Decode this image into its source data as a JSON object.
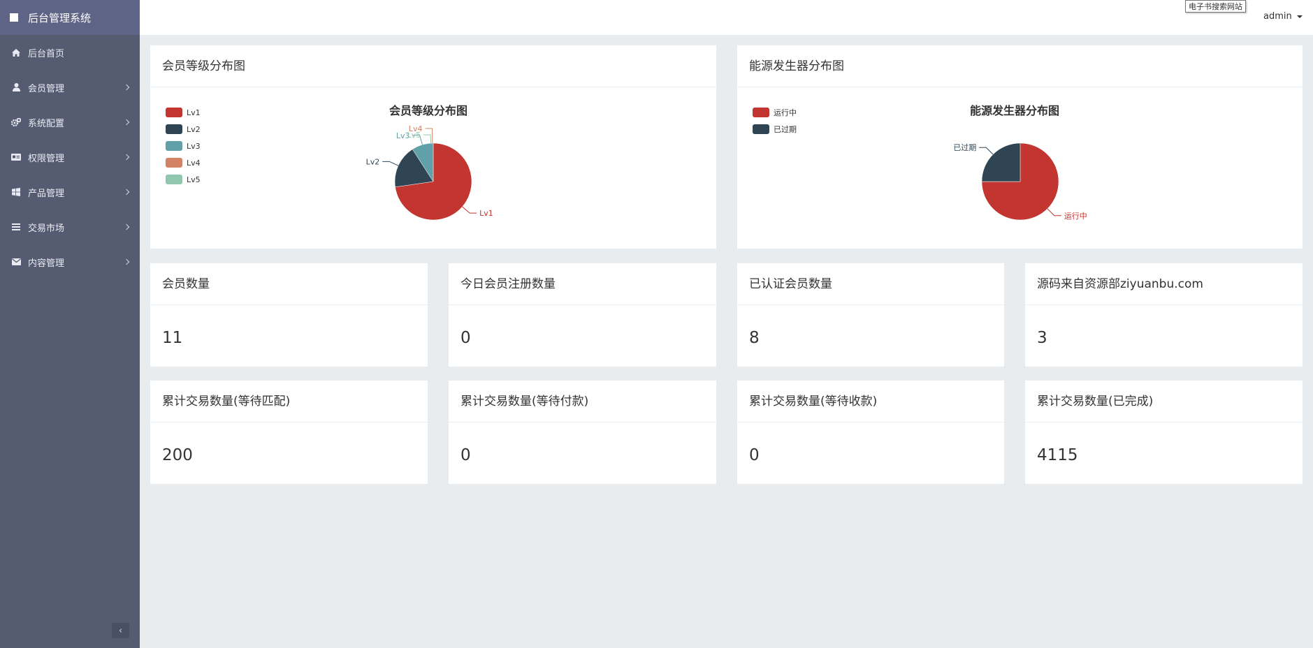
{
  "sidebar": {
    "brand": "后台管理系统",
    "items": [
      {
        "label": "后台首页",
        "icon": "home-icon",
        "submenu": false
      },
      {
        "label": "会员管理",
        "icon": "user-icon",
        "submenu": true
      },
      {
        "label": "系统配置",
        "icon": "cogs-icon",
        "submenu": true
      },
      {
        "label": "权限管理",
        "icon": "id-card-icon",
        "submenu": true
      },
      {
        "label": "产品管理",
        "icon": "windows-icon",
        "submenu": true
      },
      {
        "label": "交易市场",
        "icon": "list-icon",
        "submenu": true
      },
      {
        "label": "内容管理",
        "icon": "envelope-icon",
        "submenu": true
      }
    ],
    "collapse_label": "‹"
  },
  "header": {
    "tooltip": "电子书搜索网站",
    "user": "admin"
  },
  "charts": {
    "members": {
      "panel_title": "会员等级分布图",
      "chart_data": {
        "type": "pie",
        "title": "会员等级分布图",
        "legend_position": "top-left",
        "labels": [
          "Lv1",
          "Lv2",
          "Lv3",
          "Lv4",
          "Lv5"
        ],
        "values": [
          8,
          2,
          1,
          0,
          0
        ],
        "colors": [
          "#c23531",
          "#2f4554",
          "#61a0a8",
          "#d48265",
          "#91c7ae"
        ]
      }
    },
    "generators": {
      "panel_title": "能源发生器分布图",
      "chart_data": {
        "type": "pie",
        "title": "能源发生器分布图",
        "legend_position": "top-left",
        "labels": [
          "运行中",
          "已过期"
        ],
        "values": [
          3,
          1
        ],
        "colors": [
          "#c23531",
          "#2f4554"
        ]
      }
    }
  },
  "stats": [
    {
      "title": "会员数量",
      "value": "11"
    },
    {
      "title": "今日会员注册数量",
      "value": "0"
    },
    {
      "title": "已认证会员数量",
      "value": "8"
    },
    {
      "title": "源码来自资源部ziyuanbu.com",
      "value": "3"
    },
    {
      "title": "累计交易数量(等待匹配)",
      "value": "200"
    },
    {
      "title": "累计交易数量(等待付款)",
      "value": "0"
    },
    {
      "title": "累计交易数量(等待收款)",
      "value": "0"
    },
    {
      "title": "累计交易数量(已完成)",
      "value": "4115"
    }
  ]
}
